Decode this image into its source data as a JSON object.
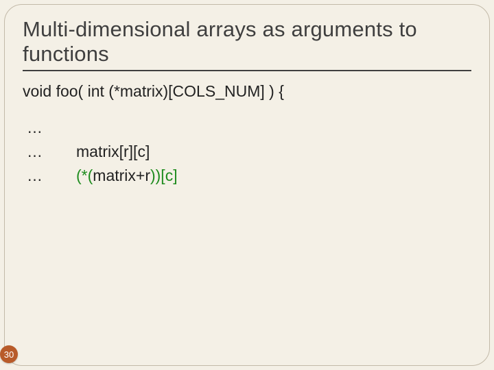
{
  "title": "Multi-dimensional arrays as arguments to functions",
  "decl": "void foo( int (*matrix)[COLS_NUM] ) {",
  "rows": {
    "r0": {
      "ell": "…",
      "expr": ""
    },
    "r1": {
      "ell": "…",
      "expr": "matrix[r][c]"
    },
    "r2": {
      "ell": "…",
      "p0": "(*(",
      "p1": "matrix+r",
      "p2": "))[c]"
    }
  },
  "page_number": "30"
}
